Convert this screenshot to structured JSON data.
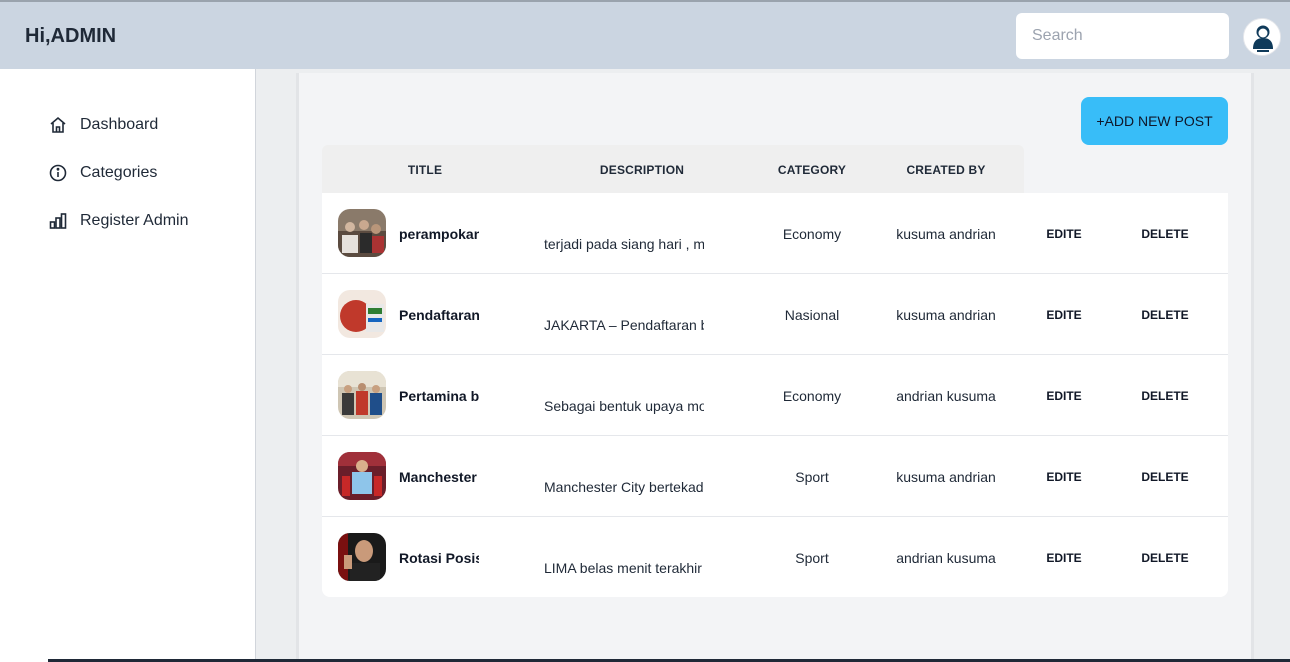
{
  "header": {
    "greeting": "Hi,ADMIN",
    "search_placeholder": "Search",
    "avatar_icon": "admin-avatar-icon"
  },
  "sidebar": {
    "items": [
      {
        "label": "Dashboard",
        "icon": "home-icon"
      },
      {
        "label": "Categories",
        "icon": "info-icon"
      },
      {
        "label": "Register Admin",
        "icon": "bar-chart-icon"
      }
    ]
  },
  "main": {
    "add_button": "+ADD NEW POST",
    "columns": [
      "TITLE",
      "DESCRIPTION",
      "CATEGORY",
      "CREATED BY"
    ],
    "rows": [
      {
        "title": "perampokan",
        "description": "terjadi pada siang hari , m",
        "category": "Economy",
        "created_by": "kusuma andrian",
        "edit": "EDITE",
        "delete": "DELETE"
      },
      {
        "title": "Pendaftaran",
        "description": "JAKARTA – Pendaftaran ba",
        "category": "Nasional",
        "created_by": "kusuma andrian",
        "edit": "EDITE",
        "delete": "DELETE"
      },
      {
        "title": "Pertamina b",
        "description": "Sebagai bentuk upaya mo",
        "category": "Economy",
        "created_by": "andrian kusuma",
        "edit": "EDITE",
        "delete": "DELETE"
      },
      {
        "title": "Manchester",
        "description": "Manchester City bertekad",
        "category": "Sport",
        "created_by": "kusuma andrian",
        "edit": "EDITE",
        "delete": "DELETE"
      },
      {
        "title": "Rotasi Posisi",
        "description": "LIMA belas menit terakhir",
        "category": "Sport",
        "created_by": "andrian kusuma",
        "edit": "EDITE",
        "delete": "DELETE"
      }
    ]
  },
  "colors": {
    "topbar": "#cbd5e1",
    "accent_button": "#38bdf8",
    "sidebar_bg": "#ffffff",
    "panel_bg": "#f3f4f6"
  }
}
